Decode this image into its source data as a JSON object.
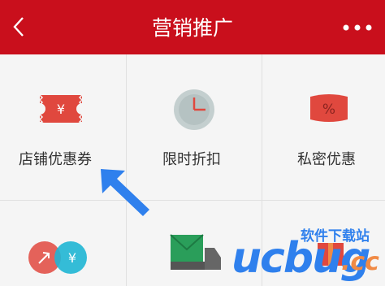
{
  "header": {
    "title": "营销推广",
    "back_icon": "chevron-left-icon",
    "more_icon": "more-dots-icon",
    "bg_color": "#c90f1c"
  },
  "grid": {
    "items": [
      {
        "label": "店铺优惠券",
        "icon": "coupon-ticket-icon",
        "icon_glyph": "¥"
      },
      {
        "label": "限时折扣",
        "icon": "clock-icon"
      },
      {
        "label": "私密优惠",
        "icon": "percent-tag-icon",
        "icon_glyph": "%"
      },
      {
        "label": "",
        "icon": "exchange-coins-icon",
        "icon_glyph": "¥"
      },
      {
        "label": "",
        "icon": "delivery-truck-icon"
      },
      {
        "label": "",
        "icon": "gift-box-icon"
      }
    ]
  },
  "watermark": {
    "brand": "ucbug",
    "domain": ".cc",
    "text": "软件下载站"
  },
  "pointer": {
    "icon": "blue-arrow-pointer-icon",
    "color": "#2f80ed"
  }
}
